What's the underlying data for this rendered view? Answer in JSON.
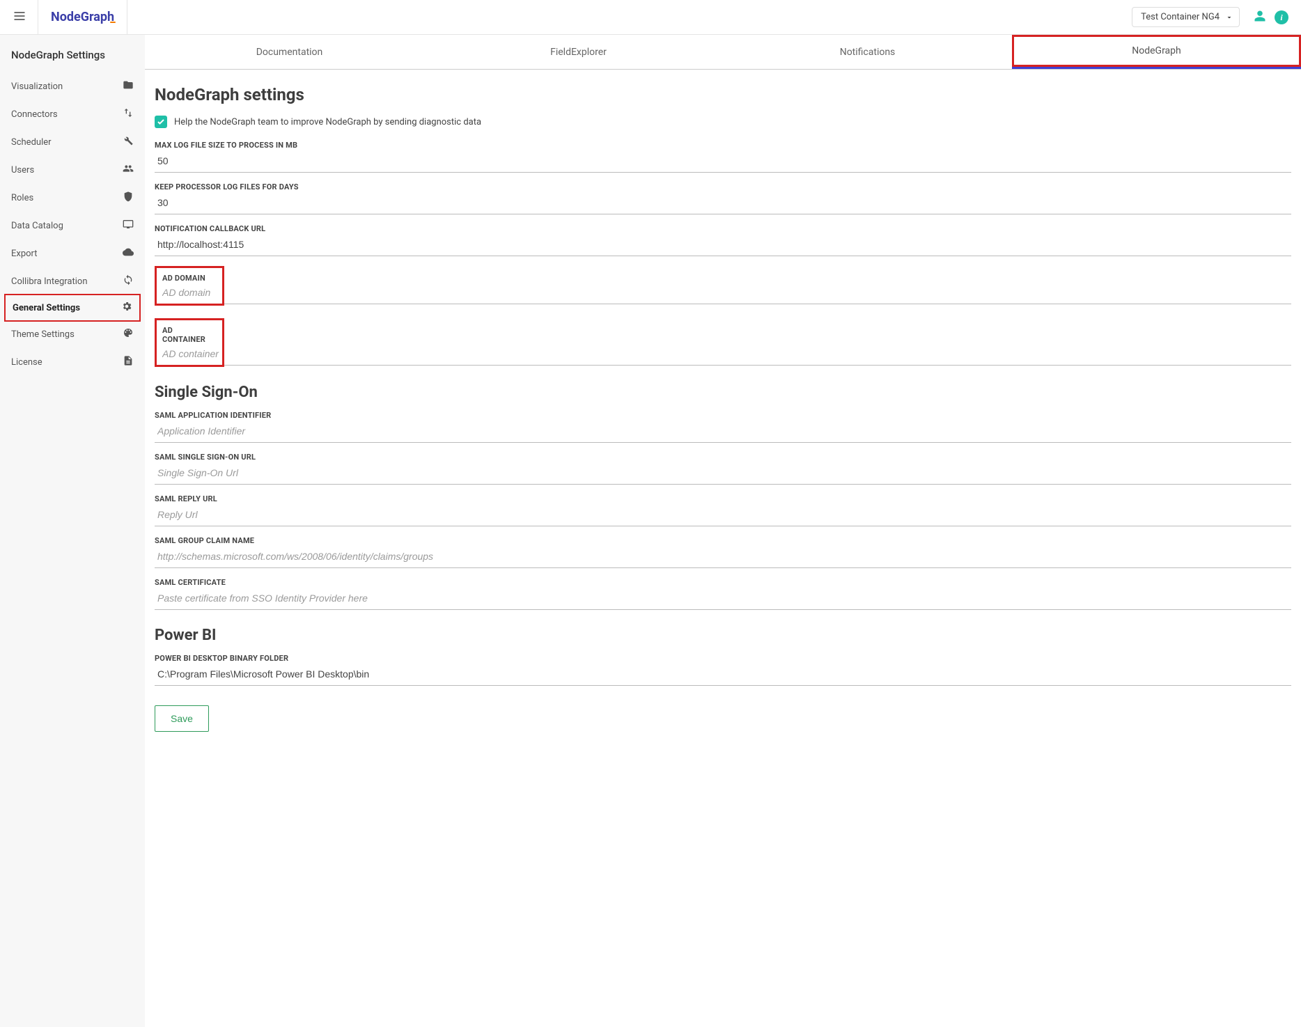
{
  "header": {
    "logo": "NodeGraph",
    "container_label": "Test Container NG4"
  },
  "sidebar": {
    "title": "NodeGraph Settings",
    "items": [
      {
        "label": "Visualization",
        "icon": "folder"
      },
      {
        "label": "Connectors",
        "icon": "swap"
      },
      {
        "label": "Scheduler",
        "icon": "wrench"
      },
      {
        "label": "Users",
        "icon": "users"
      },
      {
        "label": "Roles",
        "icon": "shield"
      },
      {
        "label": "Data Catalog",
        "icon": "display"
      },
      {
        "label": "Export",
        "icon": "cloud"
      },
      {
        "label": "Collibra Integration",
        "icon": "sync"
      },
      {
        "label": "General Settings",
        "icon": "gear",
        "active": true
      },
      {
        "label": "Theme Settings",
        "icon": "palette"
      },
      {
        "label": "License",
        "icon": "file"
      }
    ]
  },
  "tabs": [
    {
      "label": "Documentation"
    },
    {
      "label": "FieldExplorer"
    },
    {
      "label": "Notifications"
    },
    {
      "label": "NodeGraph",
      "active": true,
      "highlighted": true
    }
  ],
  "settings": {
    "page_title": "NodeGraph settings",
    "diagnostic_checkbox_label": "Help the NodeGraph team to improve NodeGraph by sending diagnostic data",
    "diagnostic_checked": true,
    "max_log_label": "MAX LOG FILE SIZE TO PROCESS IN MB",
    "max_log_value": "50",
    "keep_log_label": "KEEP PROCESSOR LOG FILES FOR DAYS",
    "keep_log_value": "30",
    "callback_label": "NOTIFICATION CALLBACK URL",
    "callback_value": "http://localhost:4115",
    "ad_domain_label": "AD DOMAIN",
    "ad_domain_placeholder": "AD domain",
    "ad_container_label": "AD CONTAINER",
    "ad_container_placeholder": "AD container"
  },
  "sso": {
    "title": "Single Sign-On",
    "app_id_label": "SAML APPLICATION IDENTIFIER",
    "app_id_placeholder": "Application Identifier",
    "signon_url_label": "SAML SINGLE SIGN-ON URL",
    "signon_url_placeholder": "Single Sign-On Url",
    "reply_url_label": "SAML REPLY URL",
    "reply_url_placeholder": "Reply Url",
    "group_claim_label": "SAML GROUP CLAIM NAME",
    "group_claim_placeholder": "http://schemas.microsoft.com/ws/2008/06/identity/claims/groups",
    "cert_label": "SAML CERTIFICATE",
    "cert_placeholder": "Paste certificate from SSO Identity Provider here"
  },
  "powerbi": {
    "title": "Power BI",
    "binary_folder_label": "POWER BI DESKTOP BINARY FOLDER",
    "binary_folder_value": "C:\\Program Files\\Microsoft Power BI Desktop\\bin"
  },
  "save_label": "Save"
}
